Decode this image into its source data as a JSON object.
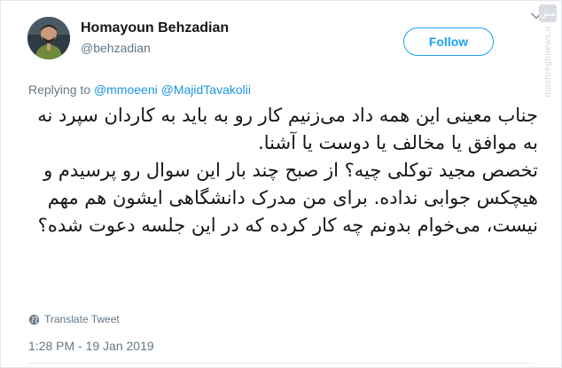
{
  "author": {
    "display_name": "Homayoun Behzadian",
    "handle": "@behzadian"
  },
  "follow_button": {
    "label": "Follow"
  },
  "reply_context": {
    "prefix": "Replying to",
    "mentions": [
      "@mmoeeni",
      "@MajidTavakolii"
    ]
  },
  "tweet": {
    "paragraphs": [
      "جناب معینی این همه داد می‌زنیم کار رو به باید به کاردان سپرد نه به موافق یا مخالف یا دوست یا آشنا.",
      "تخصص مجید توکلی چیه؟ از صبح چند بار این سوال رو پرسیدم و هیچکس جوابی نداده. برای من مدرک دانشگاهی ایشون هم مهم نیست، می‌خوام بدونم چه کار کرده که در این جلسه دعوت شده؟"
    ]
  },
  "translate": {
    "label": "Translate Tweet"
  },
  "timestamp": "1:28 PM - 19 Jan 2019",
  "watermark": {
    "text": "mashreghnews.ir",
    "logo": "مش"
  },
  "colors": {
    "accent": "#1da1f2",
    "link": "#1b95e0",
    "muted": "#657786",
    "text": "#14171a"
  },
  "icons": {
    "menu": "chevron-down-icon",
    "translate": "globe-icon",
    "watermark": "mashregh-logo-icon"
  }
}
